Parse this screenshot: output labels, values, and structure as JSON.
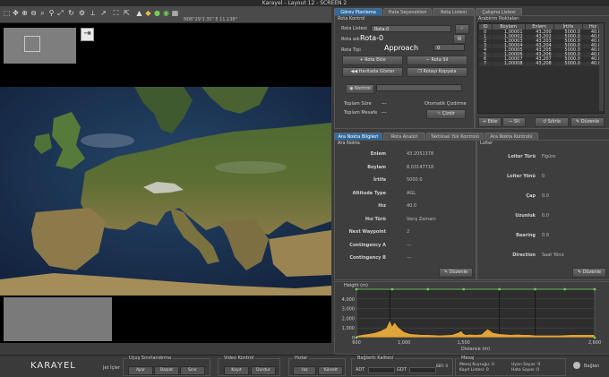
{
  "window": {
    "title": "Karayel - Layout 12 - SCREEN 2"
  },
  "map": {
    "coordinate_text": "N08°29'3.35\" E 11,138°",
    "colors": {
      "background": "#000000",
      "mini_panel": "#7e7e7e"
    }
  },
  "top_tabs": [
    "Görev Planlama",
    "Hata Seçenekleri",
    "Rota Listesi",
    "Çalışma Listesi"
  ],
  "route_panel": {
    "group_title": "Rota Kontrol",
    "route_list_label": "Rota Listesi",
    "route_list_value": "Rota-0",
    "route_name_label": "Rota adı",
    "route_name_value": "Rota-0",
    "route_type_label": "Rota Tipi",
    "route_type_value": "Approach",
    "route_index_value": "0",
    "add_route": "Rota Ekle",
    "delete_route": "Rota Sil",
    "show_on_map": "Haritada Göster",
    "copy_route": "Rotayı Kopyala",
    "check_label": "Kontrol",
    "total_time_label": "Toplam Süre",
    "total_time_value": "---",
    "total_distance_label": "Toplam Mesafe",
    "total_distance_value": "---",
    "auto_check_label": "Otomatik Çizdirme",
    "draw_button": "Çizdir"
  },
  "waypoint_list": {
    "title": "Arabirim Noktaları",
    "columns": [
      "ID",
      "Boylam",
      "Enlem",
      "İrtifa",
      "Hız"
    ],
    "rows": [
      [
        "0",
        "1,00001",
        "43,200",
        "5000.0",
        "40.0"
      ],
      [
        "1",
        "1,00002",
        "43,202",
        "5000.0",
        "40.0"
      ],
      [
        "2",
        "1,00003",
        "43,203",
        "5000.0",
        "40.0"
      ],
      [
        "3",
        "1,00004",
        "43,204",
        "5000.0",
        "40.0"
      ],
      [
        "4",
        "1,00005",
        "43,205",
        "5000.0",
        "40.0"
      ],
      [
        "5",
        "1,00006",
        "43,206",
        "5000.0",
        "40.0"
      ],
      [
        "6",
        "1,00007",
        "43,207",
        "5000.0",
        "40.0"
      ],
      [
        "7",
        "1,00008",
        "43,208",
        "5000.0",
        "40.0"
      ]
    ],
    "add_button": "Ekle",
    "delete_button": "Sil",
    "reset_button": "Sıfırla",
    "edit_button": "Düzenle"
  },
  "lower_tabs": [
    "Ara Nokta Bilgileri",
    "Rota Analizi",
    "Taktiksel Yük Kontrolü",
    "Ara Nokta Kontrolü"
  ],
  "waypoint_detail": {
    "group_title": "Ara Nokta",
    "fields": [
      {
        "label": "Enlem",
        "value": "43.2051378"
      },
      {
        "label": "Boylam",
        "value": "8.03147718"
      },
      {
        "label": "İrtifa",
        "value": "5000.0"
      },
      {
        "label": "Altitude Type",
        "value": "AGL"
      },
      {
        "label": "Hız",
        "value": "40.0"
      },
      {
        "label": "Hız Türü",
        "value": "Varış Zamanı"
      },
      {
        "label": "Next Waypoint",
        "value": "2"
      },
      {
        "label": "Contingency A",
        "value": "---"
      },
      {
        "label": "Contingency B",
        "value": "---"
      }
    ],
    "edit_button": "Düzenle"
  },
  "loiter": {
    "group_title": "Loiter",
    "fields": [
      {
        "label": "Loiter Türü",
        "value": "Figüre"
      },
      {
        "label": "Loiter Yönü",
        "value": "0"
      },
      {
        "label": "Çap",
        "value": "0.0"
      },
      {
        "label": "Uzunluk",
        "value": "0.0"
      },
      {
        "label": "Bearing",
        "value": "0.0"
      },
      {
        "label": "Direction",
        "value": "Saat Yönü"
      }
    ],
    "edit_button": "Düzenle"
  },
  "elevation_chart": {
    "title": "Height (m)",
    "xlabel": "Distance (m)"
  },
  "chart_data": {
    "type": "area",
    "title": "",
    "ylabel": "Height (m)",
    "xlabel": "Distance (m)",
    "xlim": [
      600,
      2600
    ],
    "ylim": [
      0,
      5000
    ],
    "yticks": [
      0,
      1000,
      2000,
      3000,
      4000
    ],
    "xtick_labels": [
      "600",
      "1,000",
      "1,500",
      "2,600"
    ],
    "route_altitude": 5000,
    "terrain": {
      "x": [
        600,
        650,
        700,
        750,
        800,
        850,
        880,
        900,
        920,
        950,
        980,
        1000,
        1050,
        1100,
        1150,
        1200,
        1300,
        1400,
        1450,
        1480,
        1500,
        1520,
        1550,
        1600,
        1650,
        1700,
        1750,
        1800,
        1850,
        1900,
        1950,
        2000,
        2050,
        2100,
        2200,
        2300,
        2400,
        2500,
        2600
      ],
      "y": [
        200,
        300,
        400,
        500,
        700,
        1000,
        1800,
        1200,
        1600,
        1100,
        800,
        600,
        400,
        350,
        300,
        300,
        250,
        300,
        500,
        700,
        400,
        300,
        350,
        300,
        350,
        900,
        500,
        400,
        350,
        300,
        350,
        300,
        300,
        250,
        250,
        250,
        300,
        300,
        300
      ]
    },
    "series_colors": {
      "terrain": "#e0a53a",
      "route": "#6fcf5a"
    }
  },
  "statusbar": {
    "brand": "KARAYEL",
    "flight_control": {
      "title": "Uçuş Sınırlandırma",
      "prefix": "Jet İçler",
      "buttons": [
        "Ayar",
        "Başlat",
        "Sınır"
      ]
    },
    "video_control": {
      "title": "Video Kontrol",
      "buttons": [
        "Kayıt",
        "Durdur"
      ]
    },
    "quick": {
      "title": "Hızlar",
      "buttons": [
        "Hız",
        "Yükselt"
      ]
    },
    "connection": {
      "title": "Bağlantı Kalitesi",
      "value1": "ADT",
      "value2": "GDT",
      "value3": "BER: 0"
    },
    "info": {
      "title": "Mesaj",
      "lines": [
        "Mesaj Kuyruğu: 0",
        "Kayıt Listesi: 0"
      ],
      "right": [
        "Uyarı Sayısı: 0",
        "Hata Sayısı: 0"
      ]
    },
    "exit": "Bağlan"
  }
}
